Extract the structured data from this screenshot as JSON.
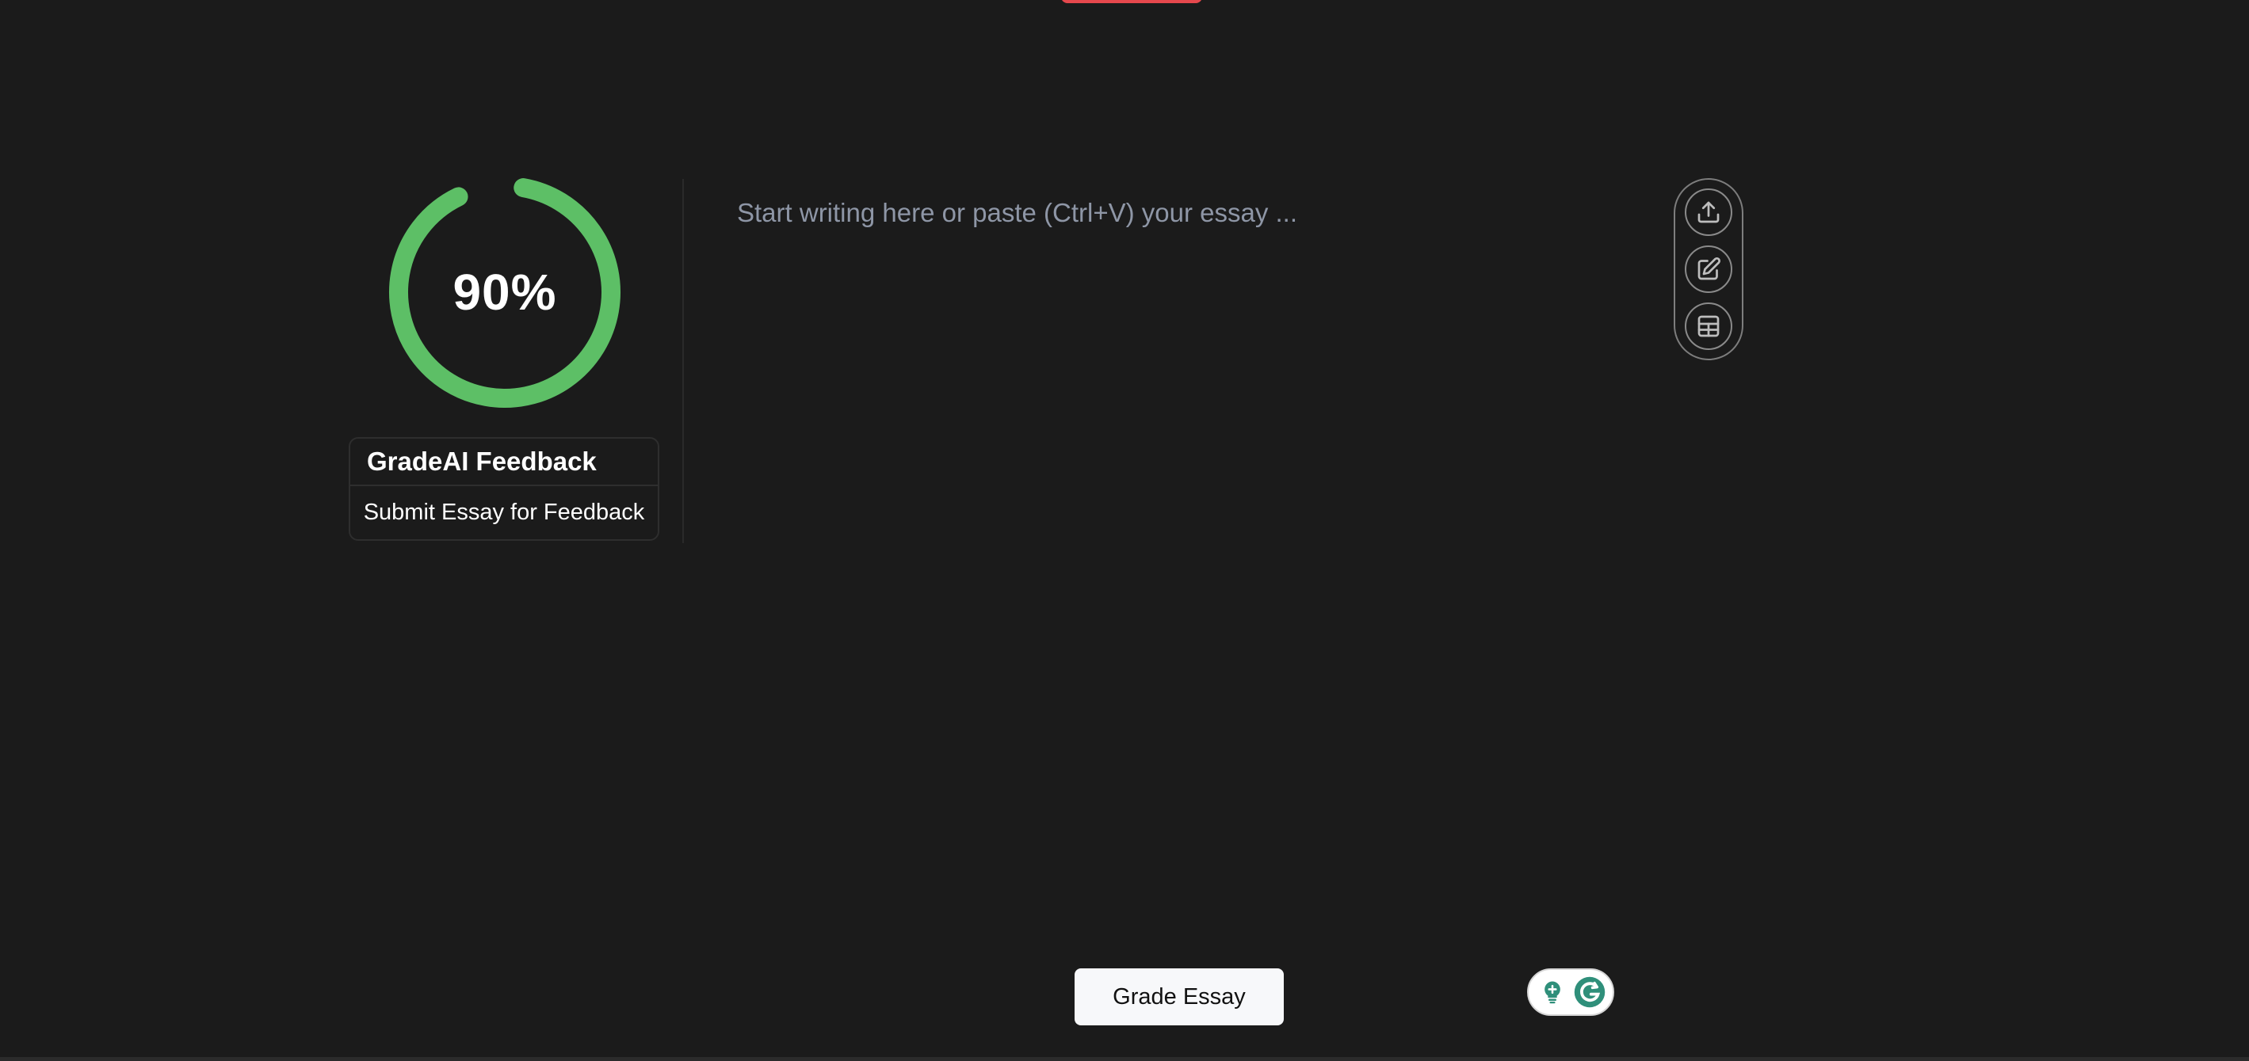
{
  "score": {
    "label": "90%",
    "value_percent": 90,
    "ring_color": "#5dbf66"
  },
  "feedback_card": {
    "title": "GradeAI Feedback",
    "action_label": "Submit Essay for Feedback"
  },
  "editor": {
    "placeholder": "Start writing here or paste (Ctrl+V) your essay ...",
    "value": ""
  },
  "toolbar": {
    "buttons": [
      {
        "icon": "upload-icon"
      },
      {
        "icon": "edit-icon"
      },
      {
        "icon": "table-icon"
      }
    ]
  },
  "grade_button": {
    "label": "Grade Essay"
  },
  "grammarly_widget": {
    "icons": [
      "lightbulb-icon",
      "grammarly-logo-icon"
    ],
    "accent_color": "#2f8f7a"
  },
  "colors": {
    "background": "#1b1b1b",
    "accent_tab": "#e5484d",
    "ring": "#5dbf66"
  }
}
